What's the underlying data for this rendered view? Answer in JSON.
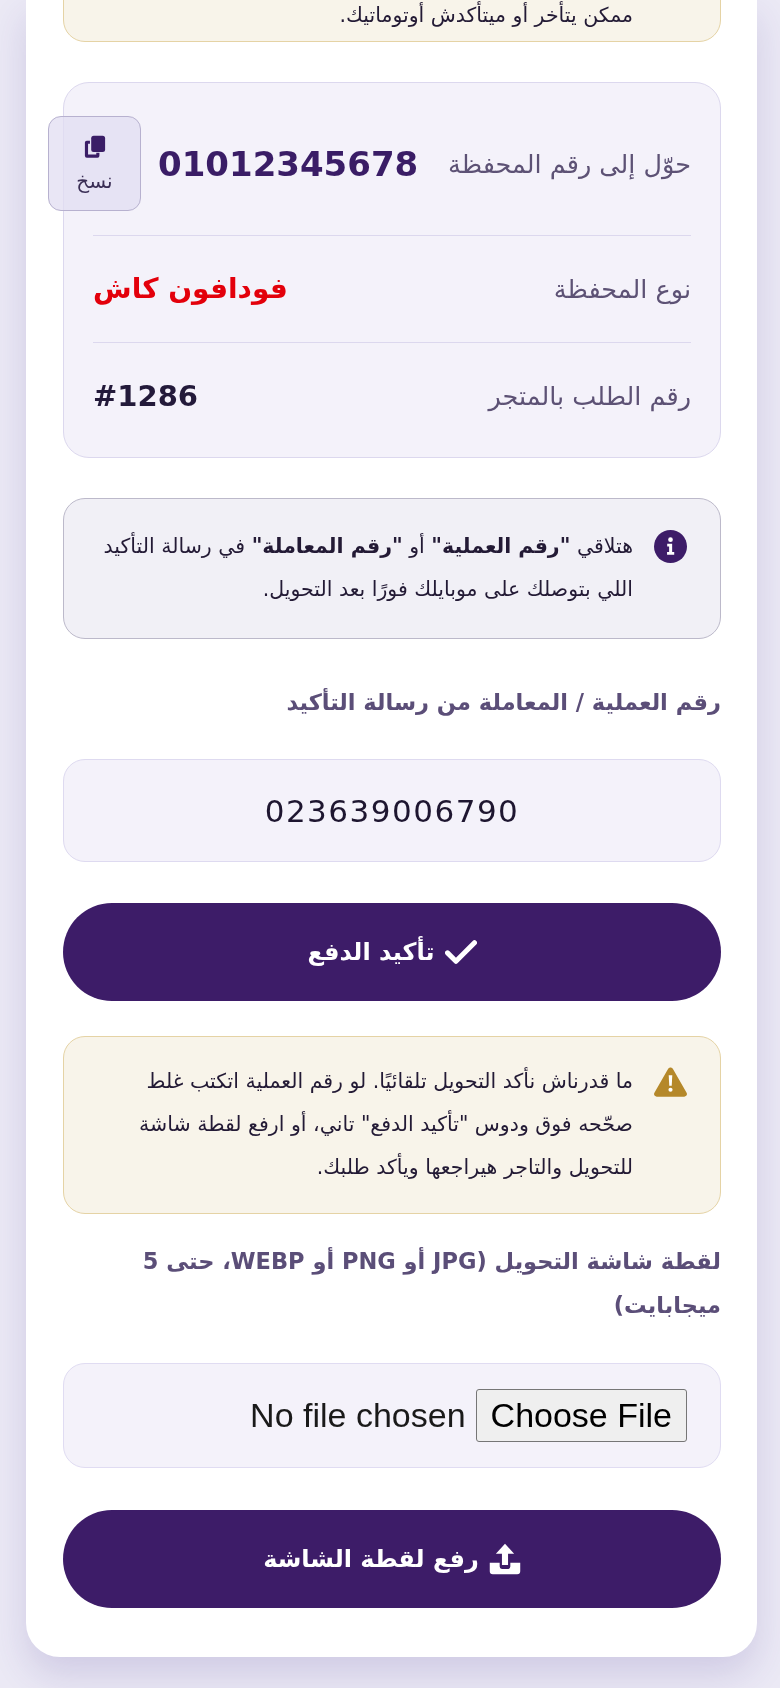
{
  "top_note": {
    "kind": "warning",
    "text": "ممكن يتأخر أو ميتأكدش أوتوماتيك."
  },
  "wallet": {
    "rows": [
      {
        "kind": "phone",
        "label": "حوّل إلى رقم المحفظة",
        "value": "01012345678",
        "copy_label": "نسخ"
      },
      {
        "kind": "provider",
        "label": "نوع المحفظة",
        "value": "فودافون كاش"
      },
      {
        "kind": "order",
        "label": "رقم الطلب بالمتجر",
        "value": "#1286"
      }
    ]
  },
  "info_note": {
    "kind": "info",
    "text": "هتلاقي **\"رقم العملية\"** أو **\"رقم المعاملة\"** في رسالة التأكيد اللي بتوصلك على موبايلك فورًا بعد التحويل."
  },
  "transaction_field": {
    "label": "رقم العملية / المعاملة من رسالة التأكيد",
    "value": "023639006790"
  },
  "confirm_button": {
    "label": "تأكيد الدفع"
  },
  "warning_note": {
    "kind": "warning",
    "text": "ما قدرناش نأكد التحويل تلقائيًا. لو رقم العملية اتكتب غلط صحّحه فوق ودوس \"تأكيد الدفع\" تاني، أو ارفع لقطة شاشة للتحويل والتاجر هيراجعها ويأكد طلبك."
  },
  "screenshot_field": {
    "label": "لقطة شاشة التحويل (JPG أو PNG أو WEBP، حتى 5 ميجابايت)",
    "button": "Choose File",
    "status": "No file chosen"
  },
  "upload_button": {
    "label": "رفع لقطة الشاشة"
  }
}
